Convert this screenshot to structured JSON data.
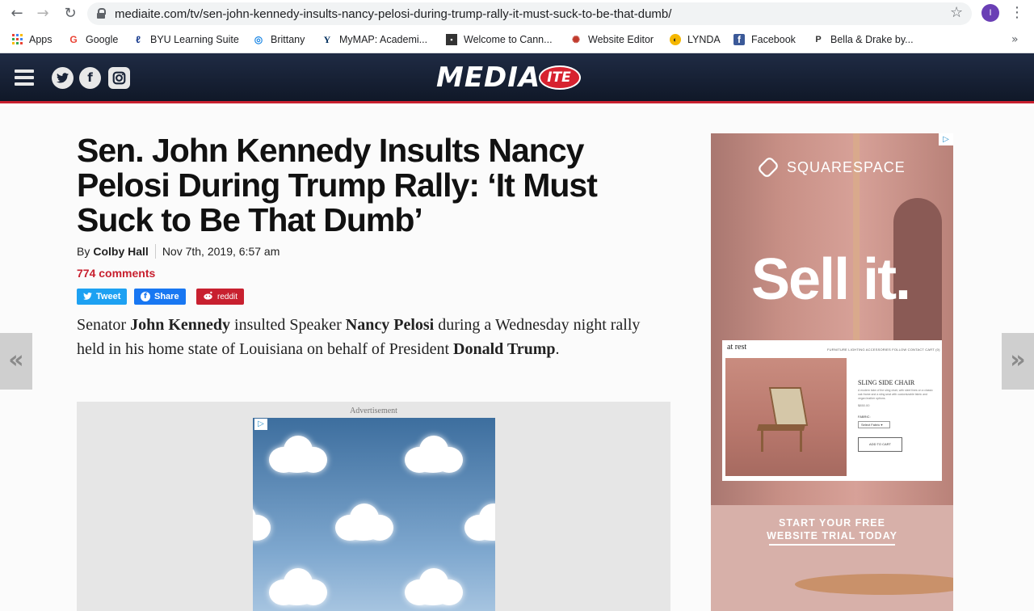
{
  "browser": {
    "url": "mediaite.com/tv/sen-john-kennedy-insults-nancy-pelosi-during-trump-rally-it-must-suck-to-be-that-dumb/",
    "profile_initial": "I",
    "back_icon": "arrow-left",
    "forward_icon": "arrow-right",
    "reload_icon": "reload",
    "bookmarks": [
      {
        "label": "Apps",
        "icon": "apps-grid-icon",
        "color": "#4285f4"
      },
      {
        "label": "Google",
        "icon": "google-icon",
        "color": "#ea4335"
      },
      {
        "label": "BYU Learning Suite",
        "icon": "learning-suite-icon",
        "color": "#1a3d8f"
      },
      {
        "label": "Brittany",
        "icon": "globe-icon",
        "color": "#1e88e5"
      },
      {
        "label": "MyMAP: Academi...",
        "icon": "byu-y-icon",
        "color": "#002e5d"
      },
      {
        "label": "Welcome to Cann...",
        "icon": "cannon-icon",
        "color": "#333333"
      },
      {
        "label": "Website Editor",
        "icon": "editor-icon",
        "color": "#c0392b"
      },
      {
        "label": "LYNDA",
        "icon": "lynda-icon",
        "color": "#f5b700"
      },
      {
        "label": "Facebook",
        "icon": "facebook-icon",
        "color": "#3b5998"
      },
      {
        "label": "Bella & Drake by...",
        "icon": "p-icon",
        "color": "#333333"
      }
    ]
  },
  "site": {
    "logo_main": "MEDIA",
    "logo_ite": "ITE",
    "brand_red": "#c8202f",
    "header_bg": "#1a2438"
  },
  "article": {
    "headline": "Sen. John Kennedy Insults Nancy Pelosi During Trump Rally: ‘It Must Suck to Be That Dumb’",
    "by_prefix": "By",
    "author": "Colby Hall",
    "date": "Nov 7th, 2019, 6:57 am",
    "comments": "774 comments",
    "share": {
      "tweet": "Tweet",
      "facebook": "Share",
      "reddit": "reddit"
    },
    "lede": {
      "p1": "Senator ",
      "b1": "John Kennedy",
      "p2": " insulted Speaker ",
      "b2": "Nancy Pelosi",
      "p3": " during a Wednesday night rally held in his home state of Louisiana on behalf of President ",
      "b3": "Donald Trump",
      "p4": "."
    },
    "ad_label": "Advertisement"
  },
  "side_ad": {
    "brand": "SQUARESPACE",
    "headline": "Sell it.",
    "site_logo": "at rest",
    "site_nav": "FURNITURE  LIGHTING  ACCESSORIES  FOLLOW  CONTACT  CART (0)",
    "product_title": "SLING SIDE CHAIR",
    "product_desc": "A modern take of the sling chair, with steel lines on a classic oak frame and a sling seat with customizable fabric and vegan leather options.",
    "price": "$850.00",
    "fabric_label": "FABRIC:",
    "fabric_select": "Select Fabric",
    "add_to_cart": "ADD TO CART",
    "cta_line1": "START YOUR FREE",
    "cta_line2": "WEBSITE TRIAL TODAY"
  },
  "nav": {
    "prev_label": "«",
    "next_label": "»"
  }
}
